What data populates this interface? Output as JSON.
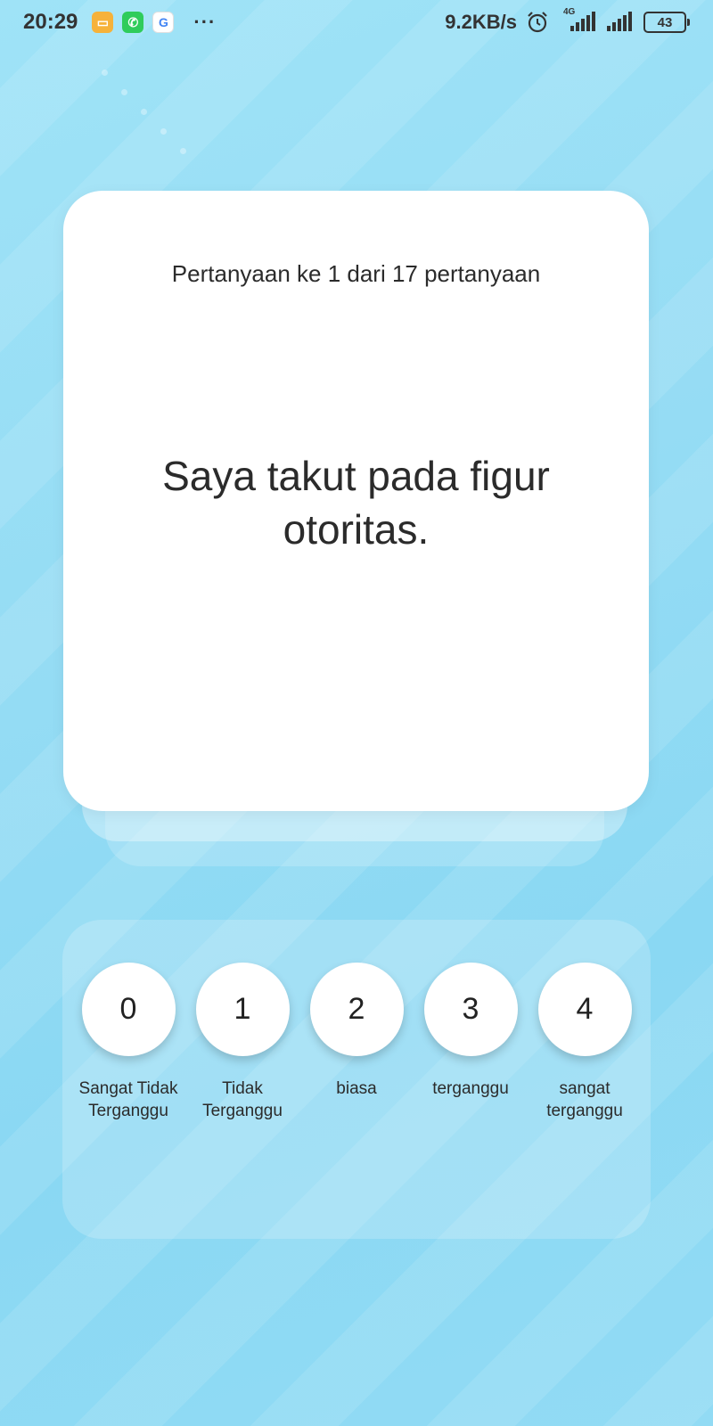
{
  "status_bar": {
    "time": "20:29",
    "net_speed": "9.2KB/s",
    "battery": "43",
    "network_type": "4G",
    "more": "···",
    "app_icons": [
      "messages-app-icon",
      "whatsapp-icon",
      "google-icon"
    ]
  },
  "question": {
    "progress": "Pertanyaan ke 1 dari 17 pertanyaan",
    "text": "Saya takut pada figur otoritas."
  },
  "options": [
    {
      "value": "0",
      "label": "Sangat Tidak Terganggu"
    },
    {
      "value": "1",
      "label": "Tidak Terganggu"
    },
    {
      "value": "2",
      "label": "biasa"
    },
    {
      "value": "3",
      "label": "terganggu"
    },
    {
      "value": "4",
      "label": "sangat terganggu"
    }
  ],
  "colors": {
    "background": "#95dcf4",
    "card": "#ffffff",
    "text": "#2b2b2b"
  }
}
